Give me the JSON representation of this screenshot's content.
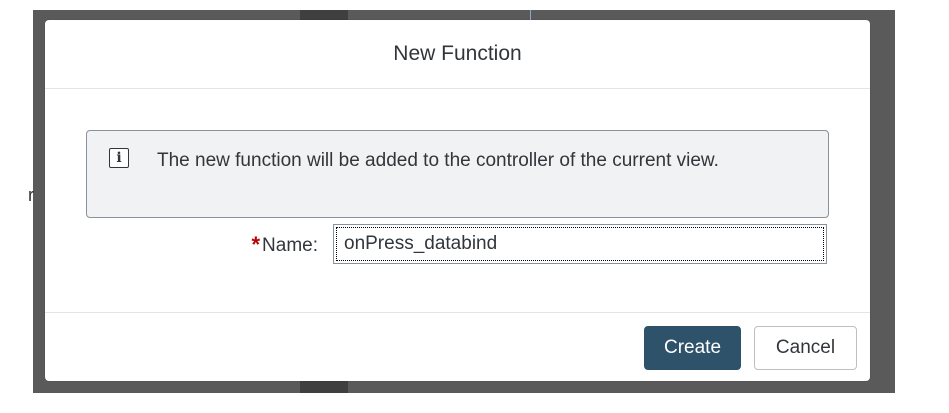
{
  "background": {
    "side_letter": "r"
  },
  "dialog": {
    "title": "New Function",
    "message": "The new function will be added to the controller of the current view.",
    "info_icon_glyph": "i",
    "form": {
      "required_marker": "*",
      "name_label": "Name:",
      "name_value": "onPress_databind"
    },
    "buttons": {
      "create_label": "Create",
      "cancel_label": "Cancel"
    }
  },
  "colors": {
    "primary_button": "#2f526b",
    "required": "#bb0000",
    "message_strip_bg": "#f0f2f4",
    "backdrop": "#5a5a5a"
  }
}
